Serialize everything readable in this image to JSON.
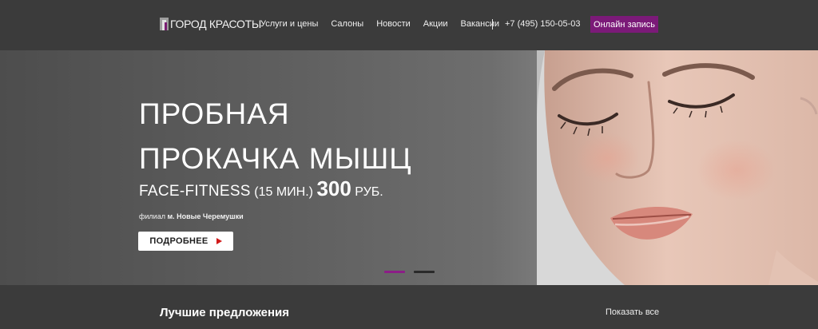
{
  "header": {
    "logo_text": "ГОРОД КРАСОТЫ",
    "nav": [
      "Услуги и цены",
      "Салоны",
      "Новости",
      "Акции",
      "Вакансии"
    ],
    "phone": "+7 (495) 150-05-03",
    "cta_label": "Онлайн запись",
    "accent_color": "#7b1a78"
  },
  "hero": {
    "title_line1": "ПРОБНАЯ",
    "title_line2": "ПРОКАЧКА МЫШЦ",
    "subtitle_service": "FACE-FITNESS",
    "subtitle_duration": "(15 МИН.)",
    "subtitle_price": "300",
    "subtitle_currency": "РУБ.",
    "branch_prefix": "филиал",
    "branch_name": "м. Новые Черемушки",
    "button_label": "ПОДРОБНЕЕ",
    "slides_total": 2,
    "active_slide": 1
  },
  "section": {
    "title": "Лучшие предложения",
    "show_all": "Показать все"
  }
}
